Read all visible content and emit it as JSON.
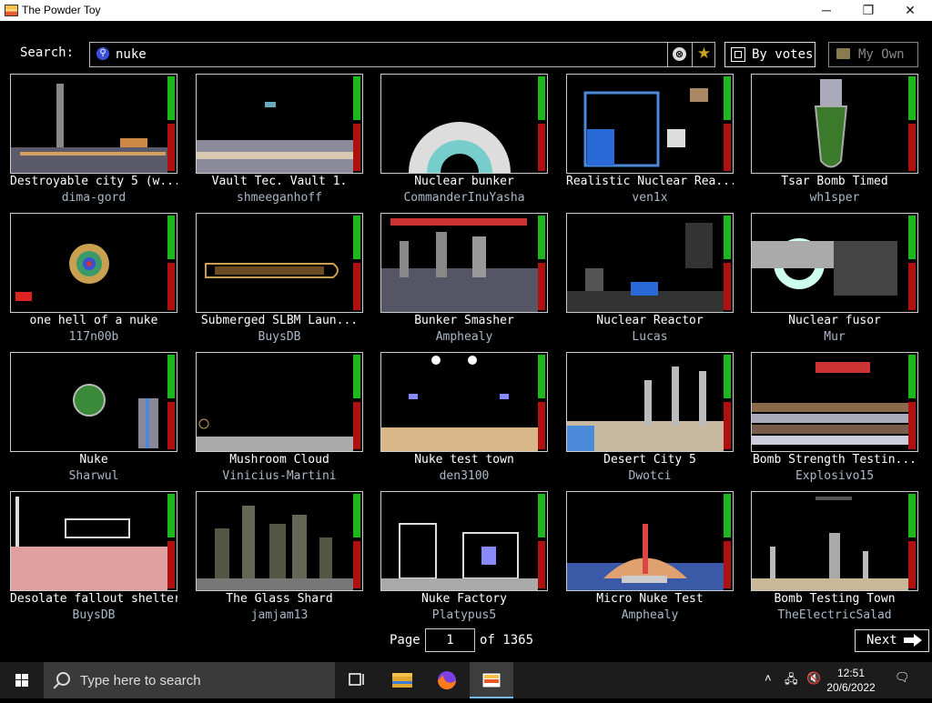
{
  "window": {
    "title": "The Powder Toy",
    "minimize": "─",
    "maximize": "❐",
    "close": "✕"
  },
  "search": {
    "label": "Search:",
    "query": "nuke",
    "clear_icon": "⊗",
    "fav_icon": "★"
  },
  "sort_button": {
    "label": "By votes"
  },
  "own_button": {
    "label": "My Own"
  },
  "saves": [
    {
      "title": "Destroyable city 5 (w...",
      "author": "dima-gord"
    },
    {
      "title": "Vault Tec. Vault 1.",
      "author": "shmeeganhoff"
    },
    {
      "title": "Nuclear bunker",
      "author": "CommanderInuYasha"
    },
    {
      "title": "Realistic Nuclear Rea...",
      "author": "ven1x"
    },
    {
      "title": "Tsar Bomb Timed",
      "author": "wh1sper"
    },
    {
      "title": "one hell of a nuke",
      "author": "117n00b"
    },
    {
      "title": "Submerged SLBM Laun...",
      "author": "BuysDB"
    },
    {
      "title": "Bunker Smasher",
      "author": "Amphealy"
    },
    {
      "title": "Nuclear Reactor",
      "author": "Lucas"
    },
    {
      "title": "Nuclear fusor",
      "author": "Mur"
    },
    {
      "title": "Nuke",
      "author": "Sharwul"
    },
    {
      "title": "Mushroom Cloud",
      "author": "Vinicius-Martini"
    },
    {
      "title": "Nuke test town",
      "author": "den3100"
    },
    {
      "title": "Desert City 5",
      "author": "Dwotci"
    },
    {
      "title": "Bomb Strength Testin...",
      "author": "Explosivo15"
    },
    {
      "title": "Desolate fallout shelter",
      "author": "BuysDB"
    },
    {
      "title": "The Glass Shard",
      "author": "jamjam13"
    },
    {
      "title": "Nuke Factory",
      "author": "Platypus5"
    },
    {
      "title": "Micro Nuke Test",
      "author": "Amphealy"
    },
    {
      "title": "Bomb Testing Town",
      "author": "TheElectricSalad"
    }
  ],
  "pagination": {
    "page_label": "Page",
    "current_page": "1",
    "of_text": "of 1365",
    "next_label": "Next"
  },
  "taskbar": {
    "search_placeholder": "Type here to search",
    "time": "12:51",
    "date": "20/6/2022"
  },
  "colors": {
    "vote_up": "#1db81d",
    "vote_down": "#b01010",
    "author_text": "#aab8c8",
    "taskbar": "#1c1c1c"
  }
}
